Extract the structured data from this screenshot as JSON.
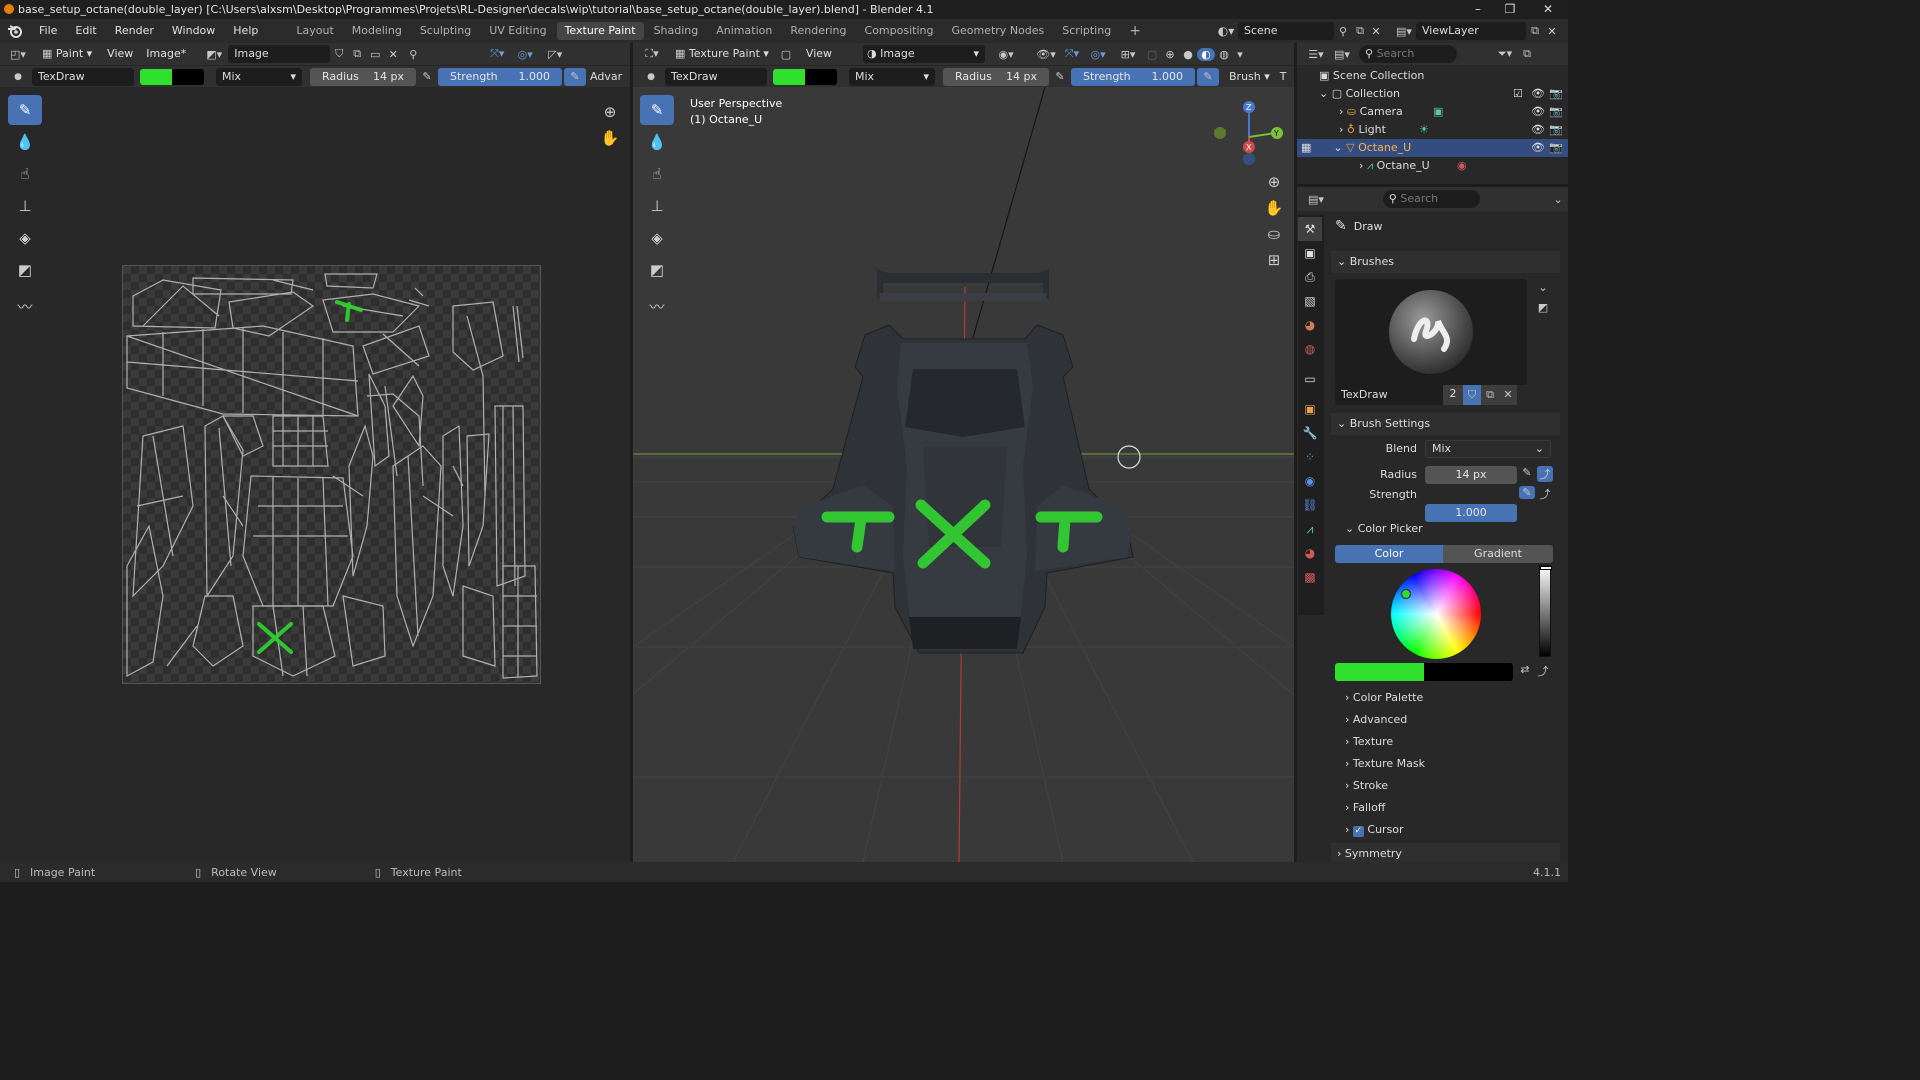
{
  "window": {
    "title": "base_setup_octane(double_layer) [C:\\Users\\alxsm\\Desktop\\Programmes\\Projets\\RL-Designer\\decals\\wip\\tutorial\\base_setup_octane(double_layer).blend] - Blender 4.1",
    "minimize": "–",
    "maximize": "❐",
    "close": "✕"
  },
  "menu": [
    "File",
    "Edit",
    "Render",
    "Window",
    "Help"
  ],
  "workspaces": [
    "Layout",
    "Modeling",
    "Sculpting",
    "UV Editing",
    "Texture Paint",
    "Shading",
    "Animation",
    "Rendering",
    "Compositing",
    "Geometry Nodes",
    "Scripting"
  ],
  "active_workspace": "Texture Paint",
  "scene_name": "Scene",
  "view_layer": "ViewLayer",
  "image_editor": {
    "mode": "Paint",
    "view_menu": "View",
    "image_menu": "Image*",
    "image_name": "Image",
    "brush_name": "TexDraw",
    "blend": "Mix",
    "radius_label": "Radius",
    "radius_value": "14 px",
    "strength_label": "Strength",
    "strength_value": "1.000",
    "advanced_label": "Advar"
  },
  "viewport": {
    "mode": "Texture Paint",
    "view_menu": "View",
    "image_name": "Image",
    "brush_name": "TexDraw",
    "blend": "Mix",
    "radius_label": "Radius",
    "radius_value": "14 px",
    "strength_label": "Strength",
    "strength_value": "1.000",
    "brush_menu": "Brush",
    "overlay_line1": "User Perspective",
    "overlay_line2": "(1) Octane_U",
    "gizmo_z": "Z",
    "gizmo_y": "Y",
    "gizmo_x": "X"
  },
  "outliner": {
    "search_placeholder": "Search",
    "root": "Scene Collection",
    "collection": "Collection",
    "items": [
      {
        "name": "Camera",
        "selected": false
      },
      {
        "name": "Light",
        "selected": false
      },
      {
        "name": "Octane_U",
        "selected": true
      }
    ],
    "child": "Octane_U"
  },
  "properties": {
    "search_placeholder": "Search",
    "tool_name": "Draw",
    "brushes_label": "Brushes",
    "brush_name": "TexDraw",
    "brush_users": "2",
    "brush_settings_label": "Brush Settings",
    "blend_label": "Blend",
    "blend_value": "Mix",
    "radius_label": "Radius",
    "radius_value": "14 px",
    "strength_label": "Strength",
    "strength_value": "1.000",
    "color_picker_label": "Color Picker",
    "color_tab": "Color",
    "gradient_tab": "Gradient",
    "subpanels": [
      "Color Palette",
      "Advanced",
      "Texture",
      "Texture Mask",
      "Stroke",
      "Falloff",
      "Cursor"
    ],
    "symmetry_label": "Symmetry"
  },
  "status_bar": {
    "items": [
      "Image Paint",
      "Rotate View",
      "Texture Paint"
    ],
    "version": "4.1.1"
  },
  "colors": {
    "accent": "#4772b3",
    "brush_color": "#2fe02f",
    "secondary_color": "#000000",
    "selected_row": "#334d80",
    "orange": "#e87d0d"
  }
}
